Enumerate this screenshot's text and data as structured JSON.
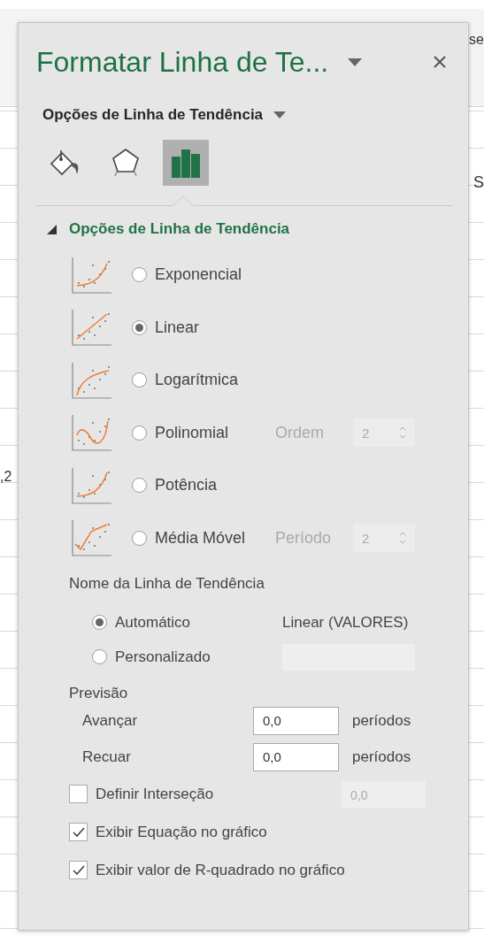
{
  "background": {
    "fragments": [
      "se",
      ",2",
      "S"
    ]
  },
  "pane": {
    "title": "Formatar Linha de Te...",
    "subtitle": "Opções de Linha de Tendência",
    "tabs": [
      {
        "kind": "fill",
        "selected": false
      },
      {
        "kind": "effects",
        "selected": false
      },
      {
        "kind": "options",
        "selected": true
      }
    ],
    "section": {
      "title": "Opções de Linha de Tendência",
      "expanded": true
    },
    "trend_types": [
      {
        "kind": "exponential",
        "label": "Exponencial",
        "selected": false
      },
      {
        "kind": "linear",
        "label": "Linear",
        "selected": true
      },
      {
        "kind": "logarithmic",
        "label": "Logarítmica",
        "selected": false
      },
      {
        "kind": "polynomial",
        "label": "Polinomial",
        "selected": false,
        "option_label": "Ordem",
        "option_value": "2",
        "disabled": true
      },
      {
        "kind": "power",
        "label": "Potência",
        "selected": false
      },
      {
        "kind": "moving_average",
        "label": "Média Móvel",
        "selected": false,
        "option_label": "Período",
        "option_value": "2",
        "disabled": true
      }
    ],
    "name_heading": "Nome da Linha de Tendência",
    "name_options": [
      {
        "label": "Automático",
        "selected": true,
        "value": "Linear (VALORES)"
      },
      {
        "label": "Personalizado",
        "selected": false,
        "disabled": true
      }
    ],
    "forecast_heading": "Previsão",
    "forecast": [
      {
        "label": "Avançar",
        "value": "0,0",
        "unit": "períodos"
      },
      {
        "label": "Recuar",
        "value": "0,0",
        "unit": "períodos"
      }
    ],
    "checkboxes": [
      {
        "label": "Definir Interseção",
        "checked": false,
        "value": "0,0",
        "disabled": true
      },
      {
        "label": "Exibir Equação no gráfico",
        "checked": true
      },
      {
        "label": "Exibir valor de R-quadrado no gráfico",
        "checked": true
      }
    ]
  }
}
